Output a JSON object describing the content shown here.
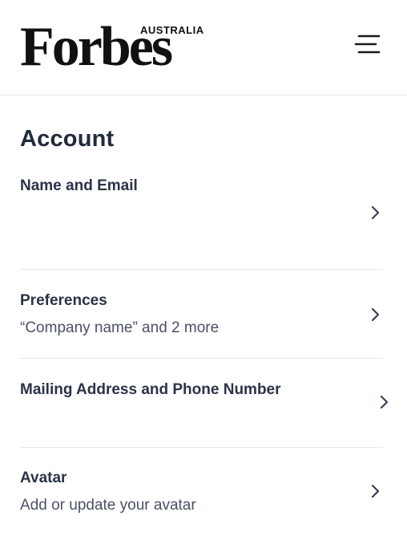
{
  "header": {
    "logo_main": "Forbes",
    "logo_sub": "AUSTRALIA",
    "menu_icon": "hamburger-menu-icon"
  },
  "account": {
    "title": "Account",
    "items": [
      {
        "label": "Name and Email",
        "subtitle": "",
        "icon": "chevron-right-icon"
      },
      {
        "label": "Preferences",
        "subtitle": "“Company name” and 2 more",
        "icon": "chevron-right-icon"
      },
      {
        "label": "Mailing Address and Phone Number",
        "subtitle": "",
        "icon": "chevron-right-icon"
      },
      {
        "label": "Avatar",
        "subtitle": "Add or update your avatar",
        "icon": "chevron-right-icon"
      }
    ]
  },
  "colors": {
    "text_primary": "#2b3346",
    "text_secondary": "#4a5163",
    "divider": "#e6e8ec",
    "logo": "#111111"
  }
}
